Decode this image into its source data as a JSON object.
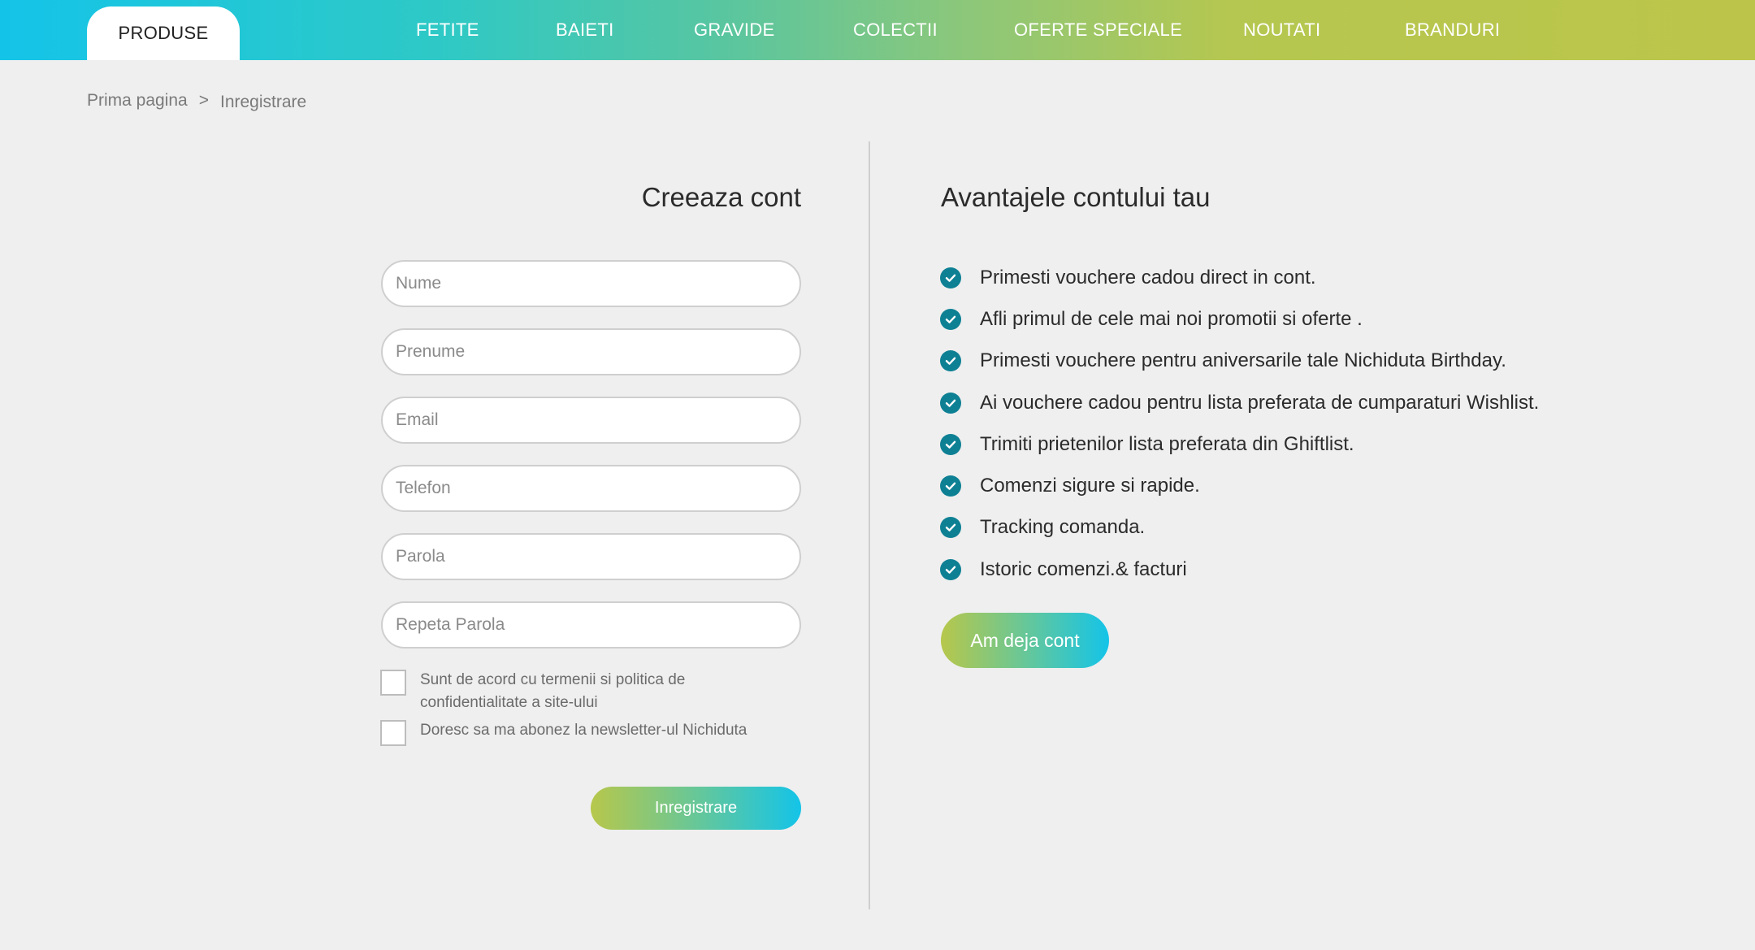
{
  "nav": {
    "active": "PRODUSE",
    "items": [
      "FETITE",
      "BAIETI",
      "GRAVIDE",
      "COLECTII",
      "OFERTE SPECIALE",
      "NOUTATI",
      "BRANDURI"
    ]
  },
  "breadcrumb": {
    "home": "Prima pagina",
    "separator": ">",
    "current": "Inregistrare"
  },
  "form": {
    "title": "Creeaza cont",
    "fields": {
      "nume": "Nume",
      "prenume": "Prenume",
      "email": "Email",
      "telefon": "Telefon",
      "parola": "Parola",
      "repeta_parola": "Repeta Parola"
    },
    "terms_label": "Sunt de acord cu termenii si politica de confidentialitate a site-ului",
    "newsletter_label": "Doresc sa ma abonez la newsletter-ul Nichiduta",
    "submit_label": "Inregistrare"
  },
  "benefits": {
    "title": "Avantajele contului tau",
    "items": [
      "Primesti vouchere cadou direct in cont.",
      "Afli primul de cele mai noi promotii si oferte .",
      "Primesti vouchere pentru aniversarile tale Nichiduta Birthday.",
      "Ai vouchere cadou pentru lista preferata de cumparaturi Wishlist.",
      "Trimiti prietenilor lista preferata din Ghiftlist.",
      "Comenzi sigure si rapide.",
      "Tracking comanda.",
      "Istoric comenzi.& facturi"
    ],
    "login_label": "Am deja cont"
  },
  "colors": {
    "accent_teal": "#0e8094",
    "gradient_start": "#14c4e8",
    "gradient_end": "#bcc54a"
  },
  "icons": {
    "benefit_check": "check-circle-icon"
  }
}
